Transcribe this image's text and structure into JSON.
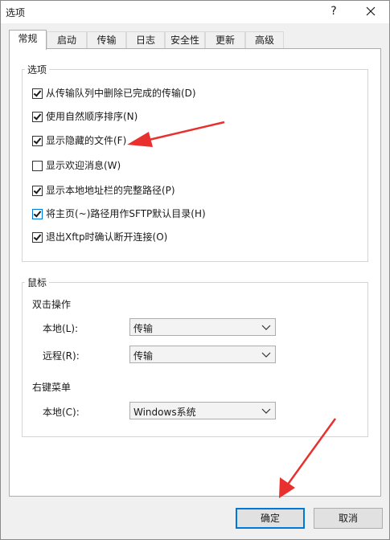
{
  "window": {
    "title": "选项",
    "help_label": "?",
    "close_label": "✕"
  },
  "tabs": [
    {
      "label": "常规",
      "active": true
    },
    {
      "label": "启动",
      "active": false
    },
    {
      "label": "传输",
      "active": false
    },
    {
      "label": "日志",
      "active": false
    },
    {
      "label": "安全性",
      "active": false
    },
    {
      "label": "更新",
      "active": false
    },
    {
      "label": "高级",
      "active": false
    }
  ],
  "options_group": {
    "legend": "选项",
    "items": [
      {
        "label": "从传输队列中删除已完成的传输(D)",
        "checked": true
      },
      {
        "label": "使用自然顺序排序(N)",
        "checked": true
      },
      {
        "label": "显示隐藏的文件(F)",
        "checked": true
      },
      {
        "label": "显示欢迎消息(W)",
        "checked": false
      },
      {
        "label": "显示本地地址栏的完整路径(P)",
        "checked": true
      },
      {
        "label": "将主页(~)路径用作SFTP默认目录(H)",
        "checked": true
      },
      {
        "label": "退出Xftp时确认断开连接(O)",
        "checked": true
      }
    ]
  },
  "mouse_group": {
    "legend": "鼠标",
    "double_click": {
      "heading": "双击操作",
      "local_label": "本地(L):",
      "local_value": "传输",
      "remote_label": "远程(R):",
      "remote_value": "传输"
    },
    "right_click": {
      "heading": "右键菜单",
      "local_label": "本地(C):",
      "local_value": "Windows系统"
    }
  },
  "buttons": {
    "ok_label": "确定",
    "cancel_label": "取消"
  },
  "colors": {
    "accent": "#0078d7",
    "annotation_arrow": "#e8312f",
    "window_bg": "#f0f0f0"
  }
}
